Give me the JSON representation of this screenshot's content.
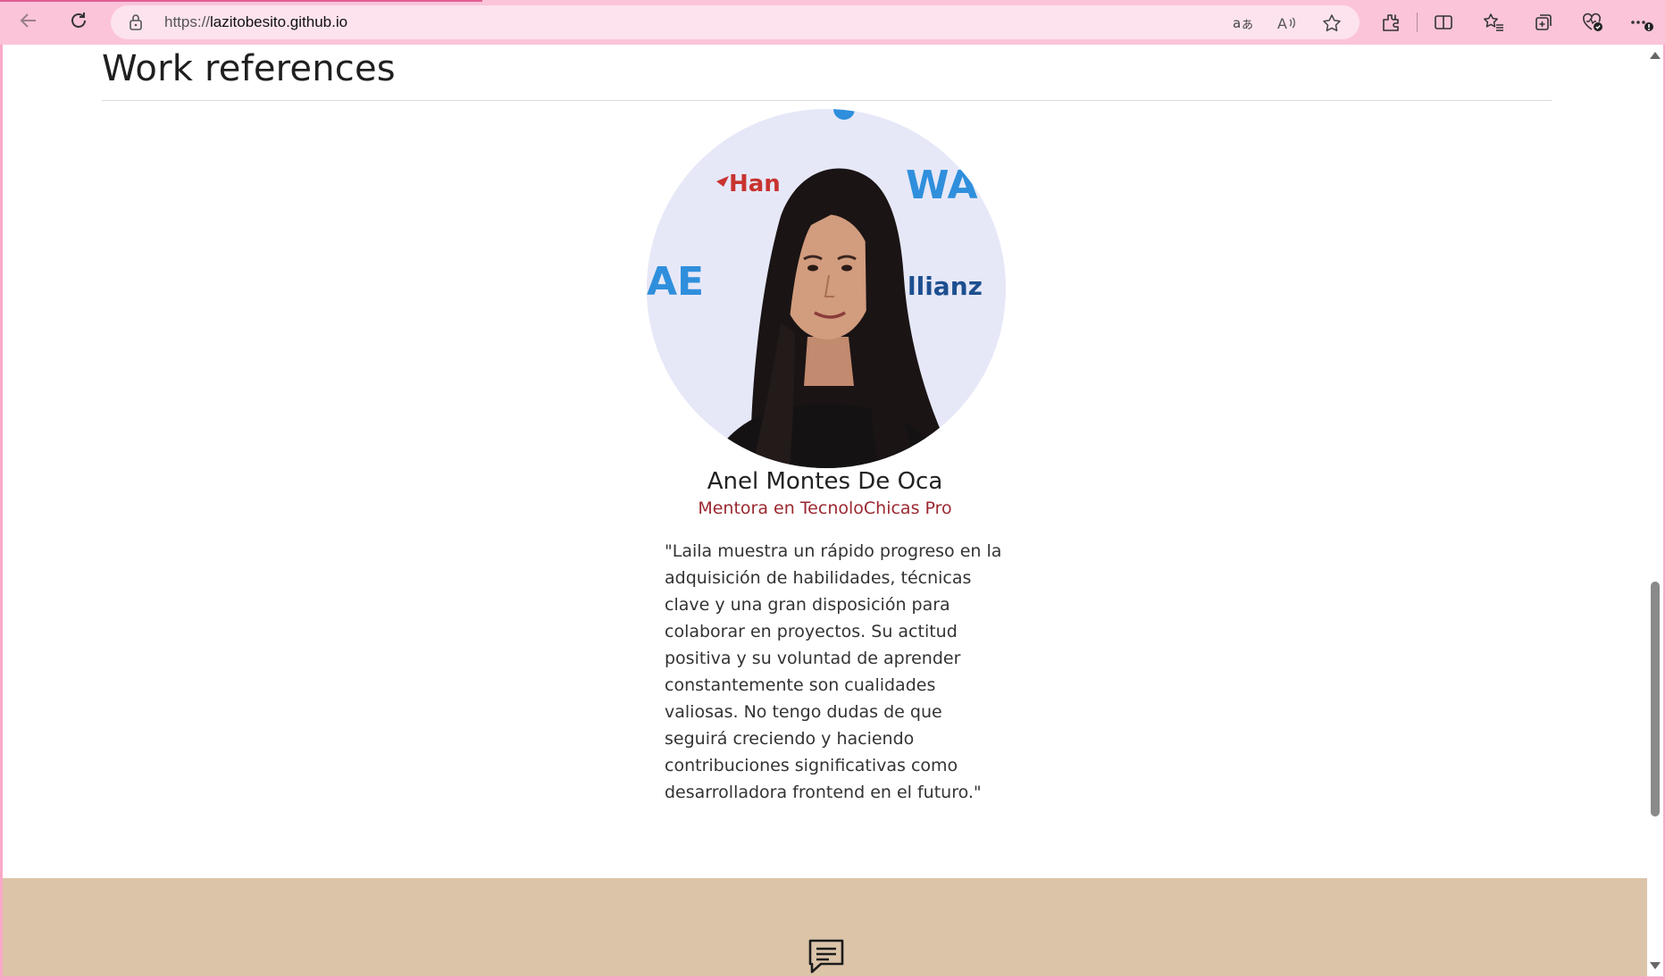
{
  "browser": {
    "url_scheme": "https://",
    "url_host": "lazitobesito.github.io",
    "icons": [
      "back-icon",
      "refresh-icon",
      "lock-icon",
      "translate-icon",
      "read-aloud-icon",
      "favorite-star-icon",
      "extensions-icon",
      "split-screen-icon",
      "favorites-icon",
      "collections-icon",
      "browser-essentials-icon",
      "more-icon"
    ]
  },
  "section": {
    "title": "Work references"
  },
  "reference": {
    "name": "Anel Montes De Oca",
    "role": "Mentora en TecnoloChicas Pro",
    "quote": "\"Laila muestra un rápido progreso en la adquisición de habilidades, técnicas clave y una gran disposición para colaborar en proyectos. Su actitud positiva y su voluntad de aprender constantemente son cualidades valiosas. No tengo dudas de que seguirá creciendo y haciendo contribuciones significativas como desarrolladora frontend en el futuro.\"",
    "photo_backdrop_text": [
      "Han",
      "WA",
      "AE",
      "llianz"
    ]
  },
  "footer": {
    "icon": "chat-icon"
  },
  "colors": {
    "chrome": "#fbc4d9",
    "role_text": "#9b2830",
    "footer_band": "#dcc4a9"
  }
}
